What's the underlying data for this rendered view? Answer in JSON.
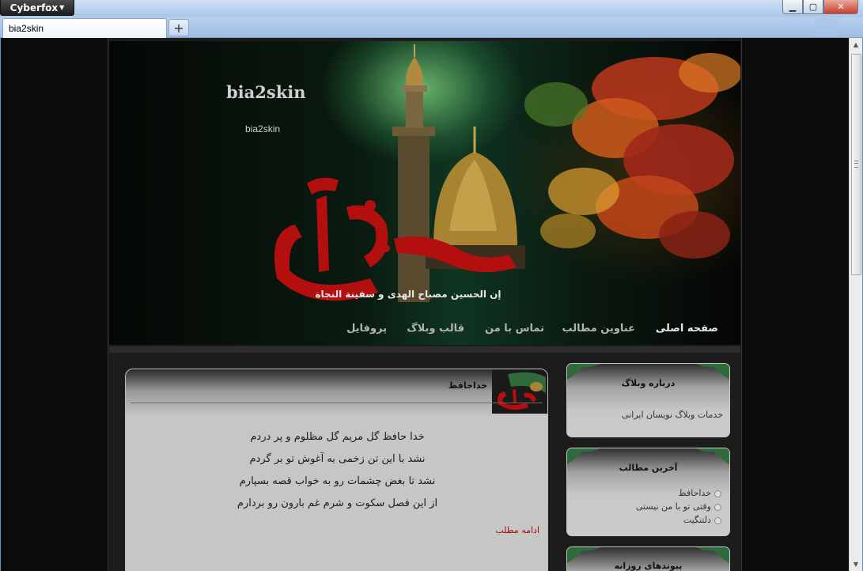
{
  "browser": {
    "app_menu_label": "Cyberfox",
    "tab_title": "bia2skin",
    "new_tab_label": "+",
    "window_buttons": {
      "minimize": "▁",
      "maximize": "▢",
      "close": "✕"
    }
  },
  "blog": {
    "title": "bia2skin",
    "description": "bia2skin",
    "banner_calligraphy": "خداحافظ",
    "banner_arabic_line": "إن الحسين مصباح الهدى و سفينة النجاة"
  },
  "nav": {
    "items": [
      {
        "label": "صفحه اصلی",
        "active": true
      },
      {
        "label": "عناوین مطالب",
        "active": false
      },
      {
        "label": "تماس با من",
        "active": false
      },
      {
        "label": "قالب وبلاگ",
        "active": false
      },
      {
        "label": "پروفایل",
        "active": false
      }
    ]
  },
  "post": {
    "title": "خداحافظ",
    "lines": [
      "خدا حافظ گل مریم گل مظلوم و پر دردم",
      "نشد با این تن زخمی به آغوش تو بر گردم",
      "نشد تا بغض چشمات رو به خواب قصه بسپارم",
      "از این فصل سکوت و شرم غم بارون رو بردارم"
    ],
    "read_more": "ادامه مطلب"
  },
  "sidebar": {
    "about": {
      "title": "درباره وبلاگ",
      "text": "خدمات وبلاگ نویسان ایرانی"
    },
    "recent": {
      "title": "آخرین مطالب",
      "items": [
        "خداحافظ",
        "وقتی تو با من نیستی",
        "دلتنگیت"
      ]
    },
    "links": {
      "title": "پیوندهای روزانه"
    }
  },
  "colors": {
    "accent_red": "#a80c0c",
    "ornament_green": "#2f6b3a",
    "page_background": "#0b0b0b"
  }
}
